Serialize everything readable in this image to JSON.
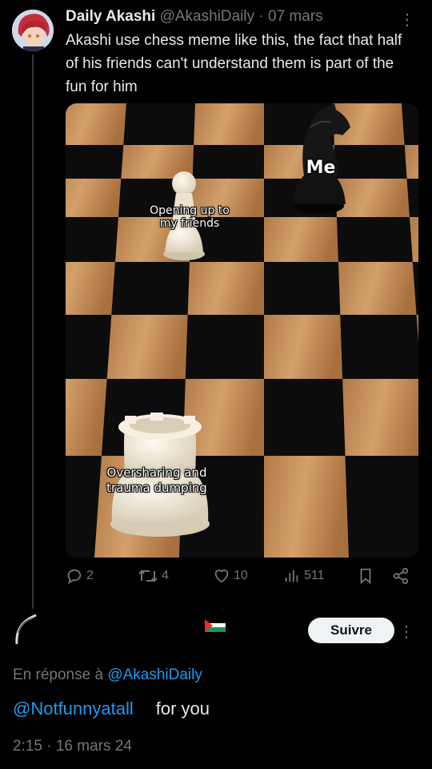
{
  "tweet": {
    "author_name": "Daily Akashi",
    "author_handle": "@AkashiDaily",
    "separator": "·",
    "date": "07 mars",
    "text": "Akashi use chess meme like this, the fact that half of his friends can't understand them is part of the fun for him",
    "meme": {
      "caption_pawn": "Opening up to\nmy friends",
      "caption_knight": "Me",
      "caption_rook": "Oversharing and\ntrauma dumping"
    },
    "stats": {
      "replies": "2",
      "retweets": "4",
      "likes": "10",
      "views": "511"
    }
  },
  "reply": {
    "follow_label": "Suivre",
    "in_reply_prefix": "En réponse à",
    "in_reply_handle": "@AkashiDaily",
    "mention": "@Notfunnyatall",
    "body": "for you",
    "timestamp": "2:15 · 16 mars 24"
  },
  "colors": {
    "background": "#000000",
    "text": "#e7e9ea",
    "muted": "#71767b",
    "link": "#1d9bf0",
    "button": "#eff3f4"
  },
  "icons": [
    "more-icon",
    "reply-icon",
    "retweet-icon",
    "like-icon",
    "views-icon",
    "bookmark-icon",
    "share-icon"
  ]
}
